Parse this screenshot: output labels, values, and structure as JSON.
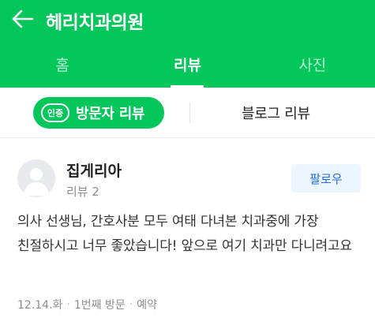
{
  "header": {
    "title": "헤리치과의원",
    "back_icon": "arrow-left-icon"
  },
  "tabs": [
    {
      "label": "홈",
      "active": false
    },
    {
      "label": "리뷰",
      "active": true
    },
    {
      "label": "사진",
      "active": false
    }
  ],
  "subtabs": {
    "visitor": {
      "badge": "인증",
      "label": "방문자 리뷰",
      "active": true
    },
    "blog": {
      "label": "블로그 리뷰",
      "active": false
    }
  },
  "review": {
    "reviewer_name": "집게리아",
    "review_count": "리뷰 2",
    "follow_label": "팔로우",
    "text": "의사 선생님, 간호사분 모두 여태 다녀본 치과중에 가장 친절하시고 너무 좋았습니다! 앞으로 여기 치과만 다니려고요",
    "meta": {
      "date": "12.14.화",
      "visit": "1번째 방문",
      "type": "예약"
    }
  },
  "colors": {
    "brand_green": "#03c75a",
    "follow_blue": "#1b6fe0",
    "follow_bg": "#edf6ff",
    "meta_gray": "#8e8e8e"
  }
}
